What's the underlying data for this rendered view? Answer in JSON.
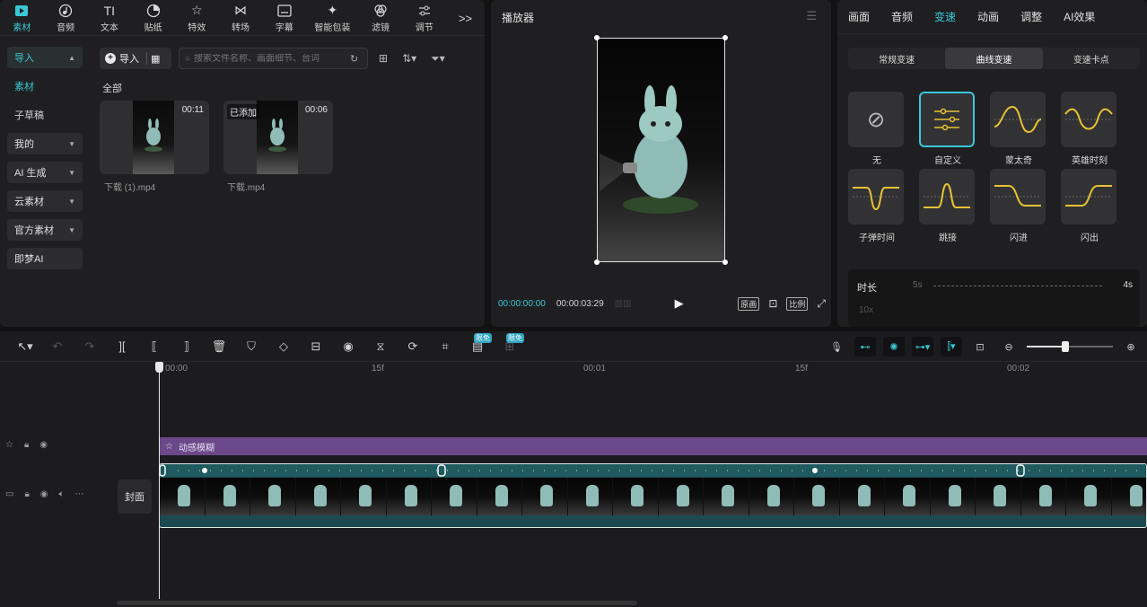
{
  "media_tabs": [
    {
      "label": "素材",
      "icon": "media-icon"
    },
    {
      "label": "音频",
      "icon": "audio-icon"
    },
    {
      "label": "文本",
      "icon": "text-icon"
    },
    {
      "label": "贴纸",
      "icon": "sticker-icon"
    },
    {
      "label": "特效",
      "icon": "effects-icon"
    },
    {
      "label": "转场",
      "icon": "transition-icon"
    },
    {
      "label": "字幕",
      "icon": "subtitle-icon"
    },
    {
      "label": "智能包装",
      "icon": "smart-pack-icon"
    },
    {
      "label": "滤镜",
      "icon": "filter-icon"
    },
    {
      "label": "调节",
      "icon": "adjust-icon"
    }
  ],
  "more_glyph": ">>",
  "left_nav": {
    "import": "导入",
    "media": "素材",
    "draft": "子草稿",
    "mine": "我的",
    "ai_gen": "AI 生成",
    "cloud": "云素材",
    "official": "官方素材",
    "jimeng": "即梦AI"
  },
  "import_button": "导入",
  "search": {
    "placeholder": "搜索文件名称、画面细节、台词"
  },
  "all_label": "全部",
  "clips": [
    {
      "name": "下载 (1).mp4",
      "duration": "00:11",
      "badge": ""
    },
    {
      "name": "下载.mp4",
      "duration": "00:06",
      "badge": "已添加"
    }
  ],
  "player": {
    "title": "播放器",
    "current_time": "00:00:00:00",
    "total_time": "00:00:03:29",
    "quality_label": "原画",
    "ratio_label": "比例"
  },
  "right_tabs": [
    "画面",
    "音频",
    "变速",
    "动画",
    "调整",
    "AI效果"
  ],
  "speed_modes": [
    "常规变速",
    "曲线变速",
    "变速卡点"
  ],
  "curves": [
    {
      "label": "无"
    },
    {
      "label": "自定义"
    },
    {
      "label": "蒙太奇"
    },
    {
      "label": "英雄时刻"
    },
    {
      "label": "子弹时间"
    },
    {
      "label": "跳接"
    },
    {
      "label": "闪进"
    },
    {
      "label": "闪出"
    }
  ],
  "duration": {
    "label": "时长",
    "from": "5s",
    "to": "4s",
    "y_label": "10x"
  },
  "timeline": {
    "free_badge_1": "限免",
    "free_badge_2": "限免",
    "ruler": [
      "00:00",
      "15f",
      "00:01",
      "15f",
      "00:02"
    ],
    "effect_label": "动感模糊",
    "cover_label": "封面"
  },
  "zoom_fraction": 0.45,
  "colors": {
    "accent": "#3ac7d6",
    "effect_track": "#6b4889",
    "video_track": "#1b4b50",
    "curve_yellow": "#e6c233"
  }
}
